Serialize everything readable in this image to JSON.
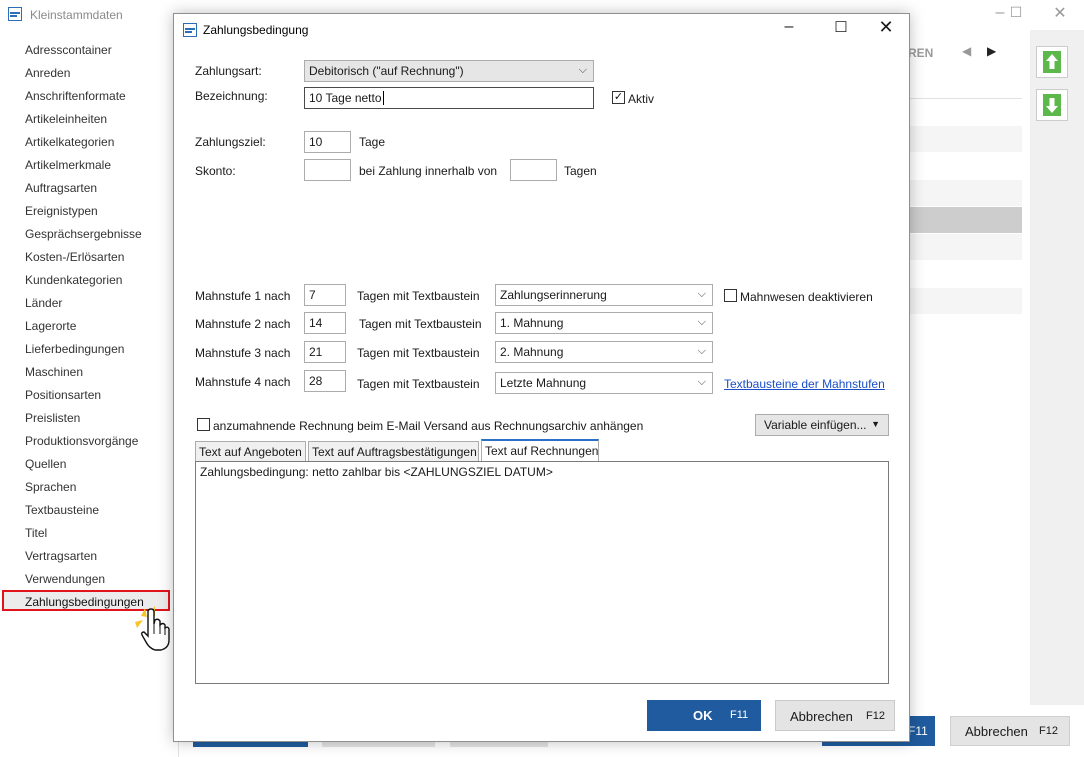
{
  "bg_window": {
    "title": "Kleinstammdaten",
    "tabs_fragment": "REN",
    "ok_key": "F11",
    "cancel_label": "Abbrechen",
    "cancel_key": "F12"
  },
  "sidebar": {
    "items": [
      "Adresscontainer",
      "Anreden",
      "Anschriftenformate",
      "Artikeleinheiten",
      "Artikelkategorien",
      "Artikelmerkmale",
      "Auftragsarten",
      "Ereignistypen",
      "Gesprächsergebnisse",
      "Kosten-/Erlösarten",
      "Kundenkategorien",
      "Länder",
      "Lagerorte",
      "Lieferbedingungen",
      "Maschinen",
      "Positionsarten",
      "Preislisten",
      "Produktionsvorgänge",
      "Quellen",
      "Sprachen",
      "Textbausteine",
      "Titel",
      "Vertragsarten",
      "Verwendungen",
      "Zahlungsbedingungen"
    ],
    "selected_index": 24
  },
  "dialog": {
    "title": "Zahlungsbedingung",
    "zahlungsart_label": "Zahlungsart:",
    "zahlungsart_value": "Debitorisch (\"auf Rechnung\")",
    "bezeichnung_label": "Bezeichnung:",
    "bezeichnung_value": "10 Tage netto",
    "aktiv_label": "Aktiv",
    "aktiv_checked": true,
    "zahlungsziel_label": "Zahlungsziel:",
    "zahlungsziel_value": "10",
    "tage_label": "Tage",
    "skonto_label": "Skonto:",
    "skonto_value": "",
    "bei_zahlung_label": "bei Zahlung innerhalb von",
    "skonto_days_value": "",
    "tagen_label": "Tagen",
    "mahnstufen": [
      {
        "label": "Mahnstufe 1 nach",
        "days": "7",
        "text_label": "Tagen mit Textbaustein",
        "baustein": "Zahlungserinnerung"
      },
      {
        "label": "Mahnstufe 2 nach",
        "days": "14",
        "text_label": "Tagen mit Textbaustein",
        "baustein": "1. Mahnung"
      },
      {
        "label": "Mahnstufe 3 nach",
        "days": "21",
        "text_label": "Tagen mit Textbaustein",
        "baustein": "2. Mahnung"
      },
      {
        "label": "Mahnstufe 4 nach",
        "days": "28",
        "text_label": "Tagen mit Textbaustein",
        "baustein": "Letzte Mahnung"
      }
    ],
    "mahnwesen_label": "Mahnwesen deaktivieren",
    "mahnwesen_checked": false,
    "textbausteine_link": "Textbausteine der Mahnstufen",
    "anhang_label": "anzumahnende Rechnung beim E-Mail Versand aus Rechnungsarchiv anhängen",
    "anhang_checked": false,
    "variable_button": "Variable einfügen...",
    "tabs": [
      "Text auf Angeboten",
      "Text auf Auftragsbestätigungen",
      "Text auf Rechnungen"
    ],
    "active_tab": 2,
    "text_content": "Zahlungsbedingung: netto zahlbar bis <ZAHLUNGSZIEL DATUM>",
    "ok_label": "OK",
    "ok_key": "F11",
    "cancel_label": "Abbrechen",
    "cancel_key": "F12"
  },
  "colors": {
    "accent": "#1f5b9e",
    "highlight": "#e0141a",
    "link": "#1a4fc6",
    "green": "#5cb84a"
  }
}
